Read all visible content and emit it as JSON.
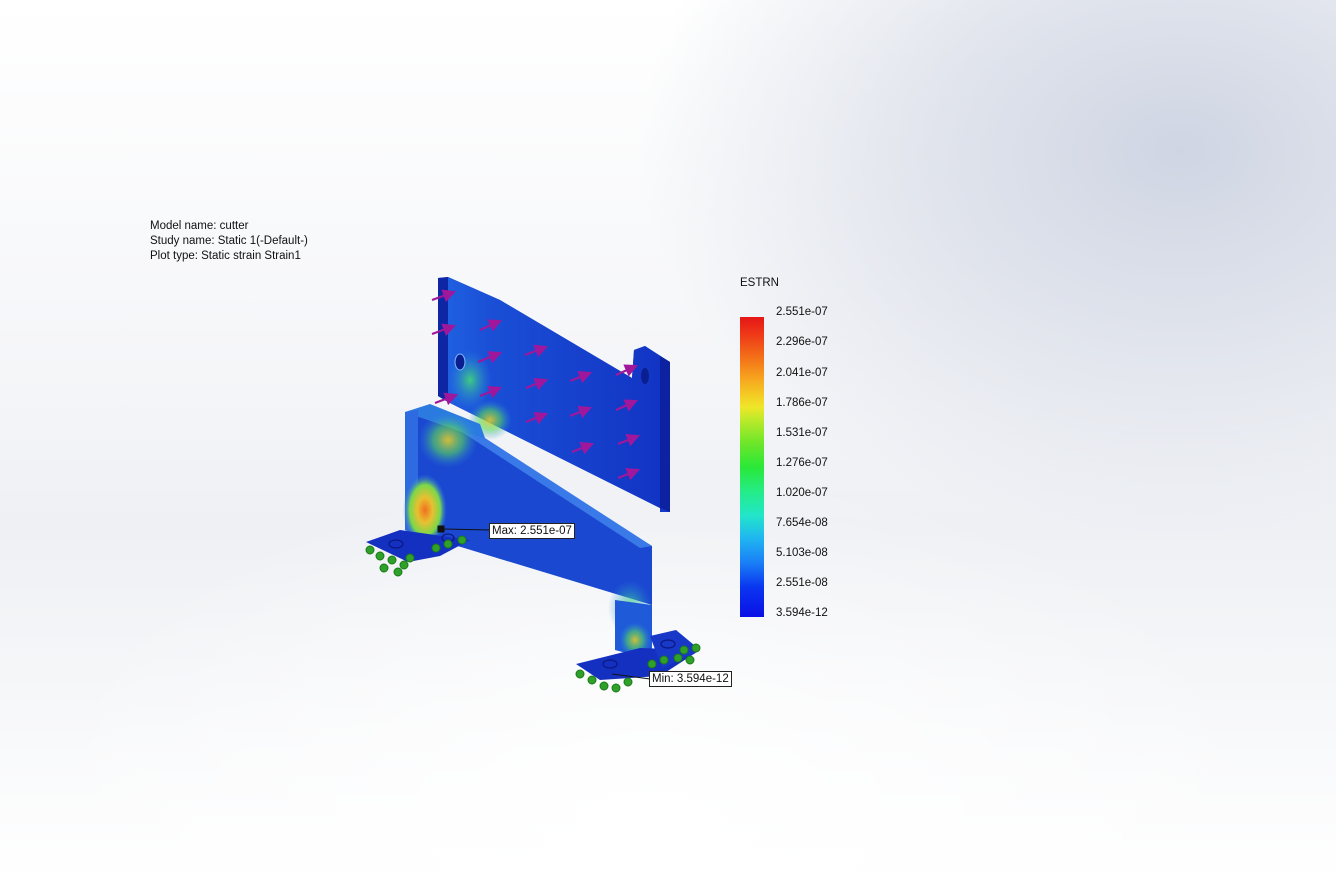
{
  "info": {
    "model_name": "Model name: cutter",
    "study_name": "Study name: Static 1(-Default-)",
    "plot_type": "Plot type: Static strain Strain1"
  },
  "legend": {
    "title": "ESTRN",
    "ticks": [
      "2.551e-07",
      "2.296e-07",
      "2.041e-07",
      "1.786e-07",
      "1.531e-07",
      "1.276e-07",
      "1.020e-07",
      "7.654e-08",
      "5.103e-08",
      "2.551e-08",
      "3.594e-12"
    ],
    "colors": {
      "max": "#e51616",
      "min": "#0a10e6"
    }
  },
  "probes": {
    "max_label": "Max: 2.551e-07",
    "min_label": "Min: 3.594e-12"
  },
  "colors": {
    "load_arrow": "#a0179c",
    "fixture": "#2fa02a",
    "mesh_base": "#1836c8"
  }
}
